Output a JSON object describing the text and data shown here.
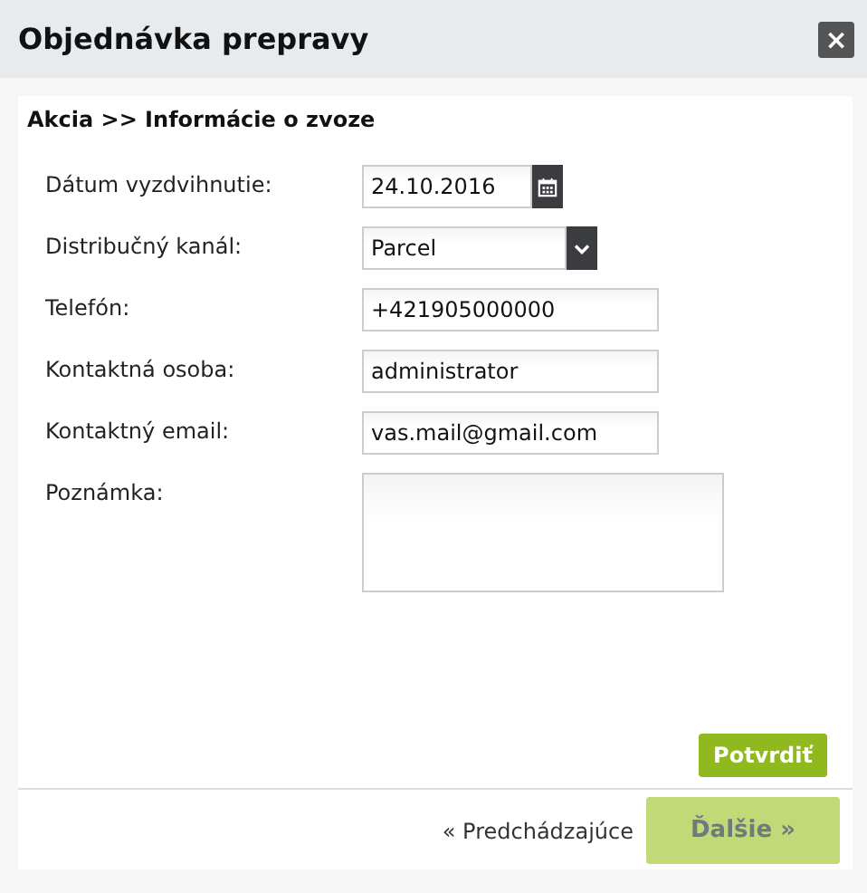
{
  "window": {
    "title": "Objednávka prepravy",
    "close": "×"
  },
  "breadcrumb": "Akcia >> Informácie o zvoze",
  "fields": [
    {
      "kind": "date",
      "label": "Dátum vyzdvihnutie:",
      "value": "24.10.2016"
    },
    {
      "kind": "select",
      "label": "Distribučný kanál:",
      "value": "Parcel"
    },
    {
      "kind": "text",
      "label": "Telefón:",
      "value": "+421905000000"
    },
    {
      "kind": "text",
      "label": "Kontaktná osoba:",
      "value": "administrator"
    },
    {
      "kind": "text",
      "label": "Kontaktný email:",
      "value": "vas.mail@gmail.com"
    },
    {
      "kind": "textarea",
      "label": "Poznámka:"
    }
  ],
  "confirm_button": {
    "label": "Potvrdiť",
    "disabled": false
  },
  "footer": {
    "previous": "« Predchádzajúce",
    "next": {
      "label": "Ďalšie »",
      "disabled": true
    }
  }
}
